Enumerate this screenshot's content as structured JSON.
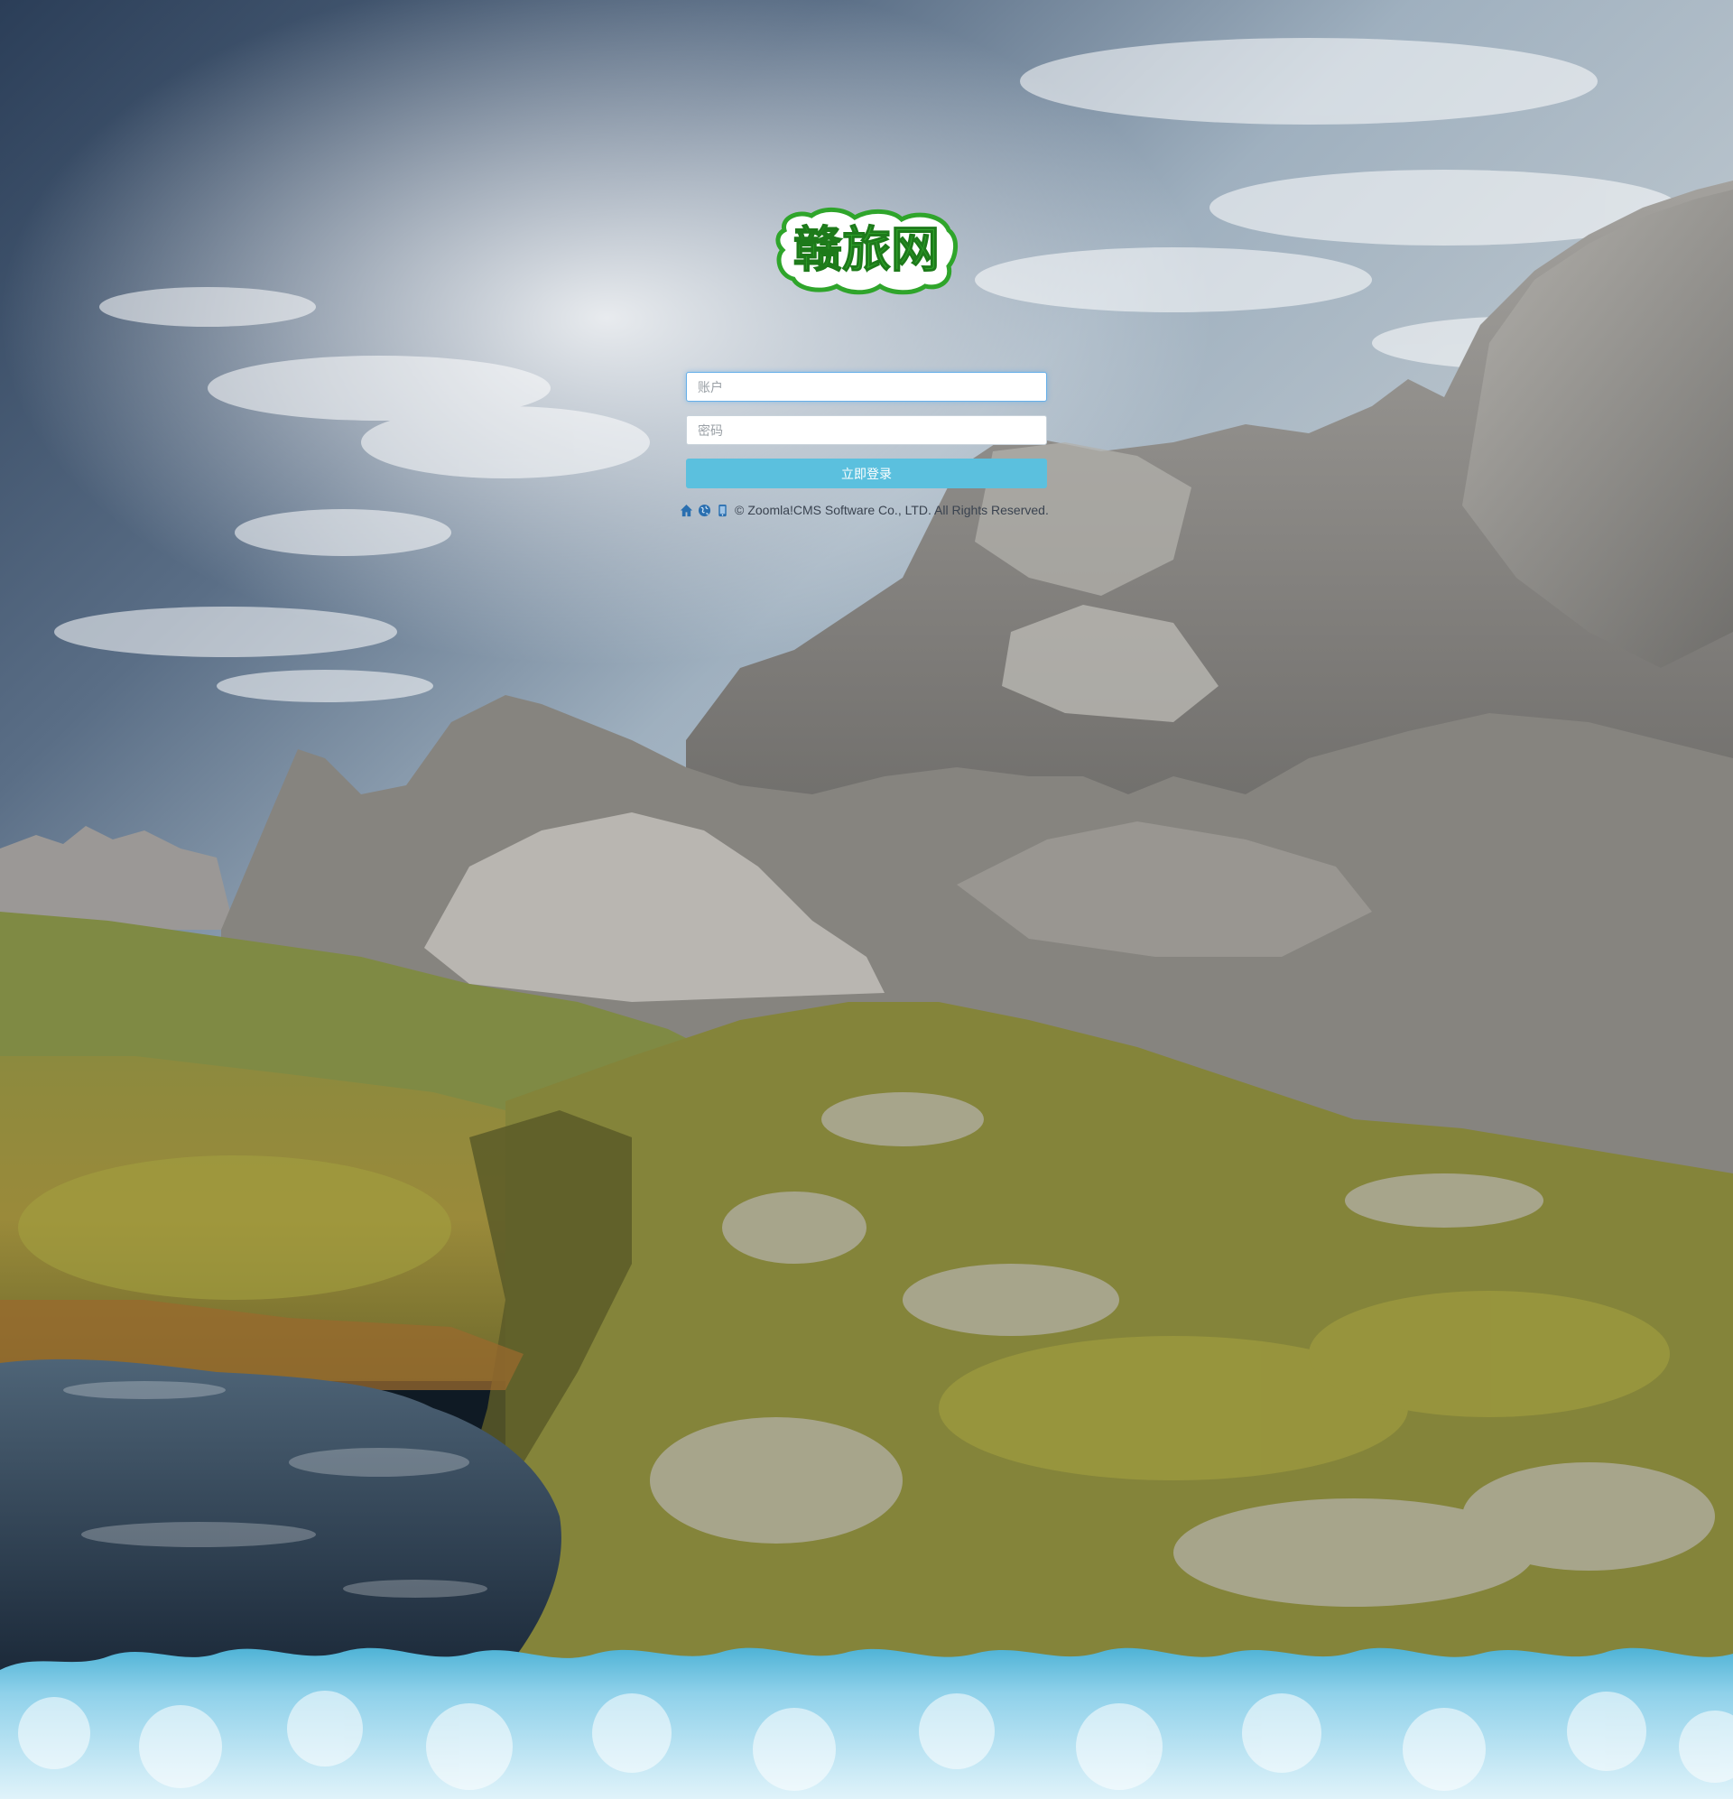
{
  "login": {
    "logo_text": "赣旅网",
    "account_placeholder": "账户",
    "password_placeholder": "密码",
    "submit_label": "立即登录"
  },
  "footer": {
    "icons": [
      "home-icon",
      "globe-icon",
      "mobile-icon"
    ],
    "copyright_symbol": "©",
    "copyright_text": "Zoomla!CMS Software Co., LTD. All Rights Reserved."
  },
  "colors": {
    "button": "#5bc0de",
    "logo_green": "#2fa52b",
    "footer_icon": "#2a6fb0"
  }
}
